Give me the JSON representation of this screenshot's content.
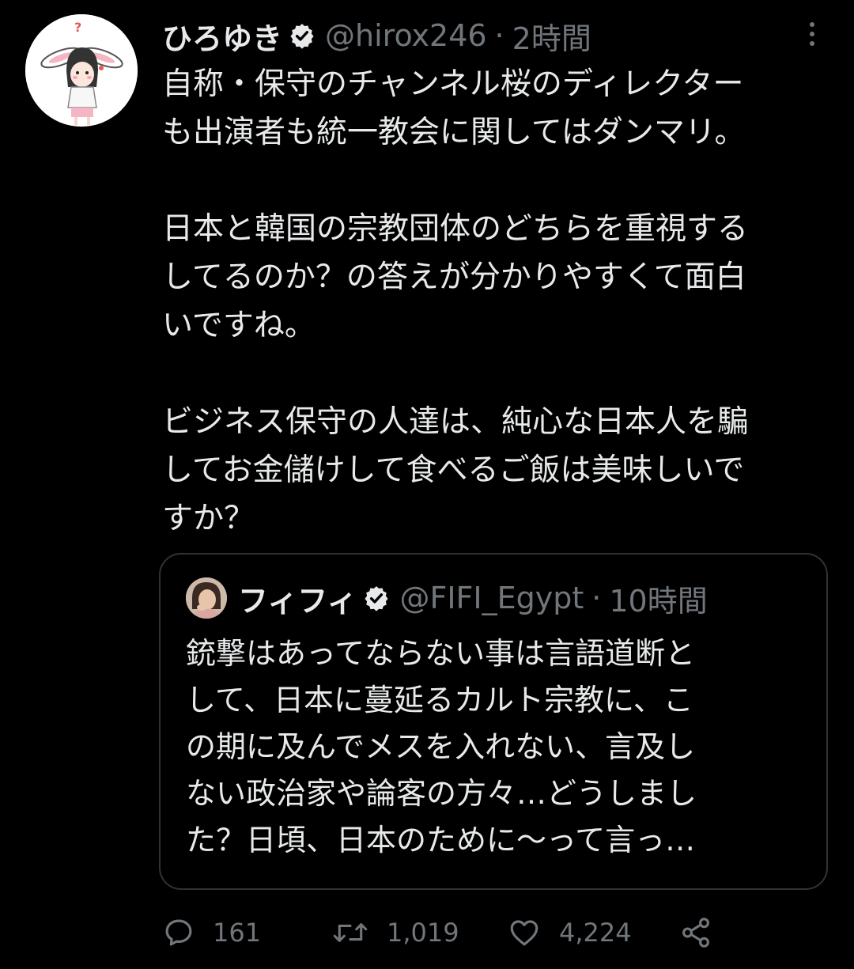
{
  "tweet": {
    "author_name": "ひろゆき",
    "handle": "@hirox246",
    "separator": "·",
    "time_ago": "2時間",
    "text": "自称・保守のチャンネル桜のディレクター\nも出演者も統一教会に関してはダンマリ。\n\n日本と韓国の宗教団体のどちらを重視する\nしてるのか？の答えが分かりやすくて面白\nいですね。\n\nビジネス保守の人達は、純心な日本人を騙\nしてお金儲けして食べるご飯は美味しいで\nすか？"
  },
  "quoted_tweet": {
    "author_name": "フィフィ",
    "handle": "@FIFI_Egypt",
    "separator": "·",
    "time_ago": "10時間",
    "text": "銃撃はあってならない事は言語道断と\nして、日本に蔓延るカルト宗教に、こ\nの期に及んでメスを入れない、言及し\nない政治家や論客の方々…どうしまし\nた？日頃、日本のために〜って言っ…"
  },
  "actions": {
    "replies": "161",
    "retweets": "1,019",
    "likes": "4,224"
  },
  "icons": {
    "verified": "verified-badge-icon",
    "more": "more-options-icon",
    "reply": "reply-icon",
    "retweet": "retweet-icon",
    "like": "heart-icon",
    "share": "share-icon"
  },
  "colors": {
    "background": "#000000",
    "text_primary": "#e7e9ea",
    "text_secondary": "#71767b",
    "border": "#2f3336"
  }
}
